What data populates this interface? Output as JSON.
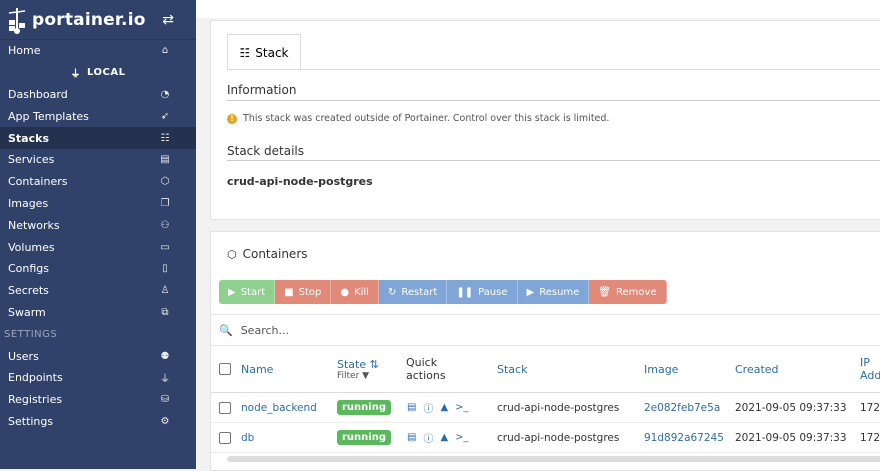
{
  "sidebar": {
    "brand": "portainer.io",
    "toggle_icon": "exchange-icon",
    "home": "Home",
    "endpoint": "LOCAL",
    "items": [
      {
        "label": "Dashboard",
        "icon": "tachometer-icon"
      },
      {
        "label": "App Templates",
        "icon": "rocket-icon"
      },
      {
        "label": "Stacks",
        "icon": "list-icon",
        "active": true
      },
      {
        "label": "Services",
        "icon": "list-alt-icon"
      },
      {
        "label": "Containers",
        "icon": "cubes-icon"
      },
      {
        "label": "Images",
        "icon": "clone-icon"
      },
      {
        "label": "Networks",
        "icon": "sitemap-icon"
      },
      {
        "label": "Volumes",
        "icon": "hdd-icon"
      },
      {
        "label": "Configs",
        "icon": "file-code-icon"
      },
      {
        "label": "Secrets",
        "icon": "user-secret-icon"
      },
      {
        "label": "Swarm",
        "icon": "object-group-icon"
      }
    ],
    "settings_heading": "SETTINGS",
    "settings_items": [
      {
        "label": "Users",
        "icon": "users-icon"
      },
      {
        "label": "Endpoints",
        "icon": "plug-icon"
      },
      {
        "label": "Registries",
        "icon": "database-icon"
      },
      {
        "label": "Settings",
        "icon": "cogs-icon"
      }
    ]
  },
  "stack_panel": {
    "tab": "Stack",
    "info_heading": "Information",
    "info_note": "This stack was created outside of Portainer. Control over this stack is limited.",
    "details_heading": "Stack details",
    "stack_name": "crud-api-node-postgres"
  },
  "containers_panel": {
    "heading": "Containers",
    "actions": [
      "Start",
      "Stop",
      "Kill",
      "Restart",
      "Pause",
      "Resume",
      "Remove"
    ],
    "search_placeholder": "Search...",
    "columns": {
      "name": "Name",
      "state": "State",
      "filter": "Filter",
      "quick_actions_1": "Quick",
      "quick_actions_2": "actions",
      "stack": "Stack",
      "image": "Image",
      "created": "Created",
      "ip_1": "IP",
      "ip_2": "Add"
    },
    "rows": [
      {
        "name": "node_backend",
        "state": "running",
        "stack": "crud-api-node-postgres",
        "image": "2e082feb7e5a",
        "created": "2021-09-05 09:37:33",
        "ip": "172."
      },
      {
        "name": "db",
        "state": "running",
        "stack": "crud-api-node-postgres",
        "image": "91d892a67245",
        "created": "2021-09-05 09:37:33",
        "ip": "172."
      }
    ]
  },
  "colors": {
    "sidebar": "#30426a",
    "running": "#5cb85c",
    "link": "#2e6da4"
  }
}
